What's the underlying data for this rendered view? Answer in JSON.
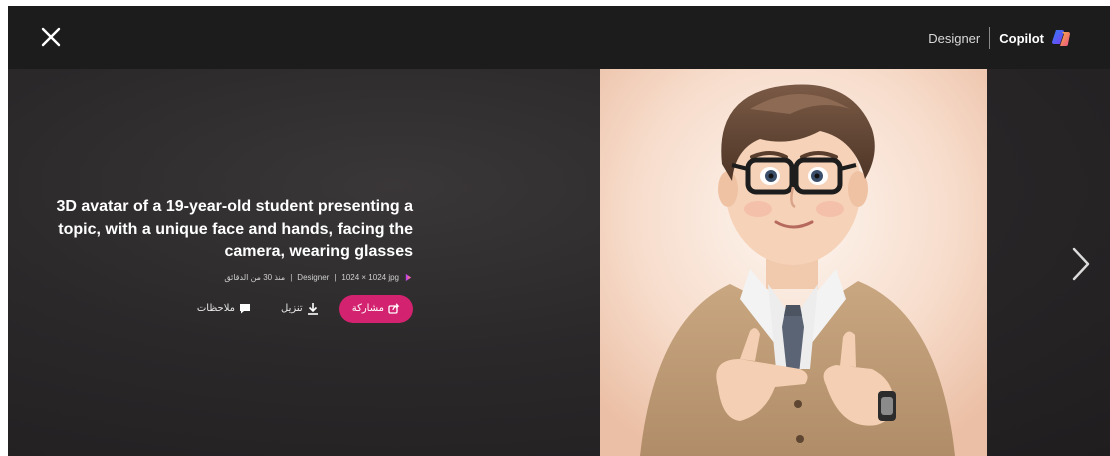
{
  "topbar": {
    "close_icon": "close-icon",
    "brand_designer": "Designer",
    "brand_copilot": "Copilot",
    "copilot_logo": "copilot-logo-icon"
  },
  "image_info": {
    "title_lines": [
      "3D avatar of a 19-year-old student presenting a",
      "topic, with a unique face and hands, facing the",
      "camera, wearing glasses"
    ],
    "meta": {
      "format": "1024 × 1024 jpg",
      "separator": "|",
      "app": "Designer",
      "time": "منذ 30 من الدقائق"
    }
  },
  "actions": {
    "share_label": "مشاركة",
    "download_label": "تنزيل",
    "feedback_label": "ملاحظات"
  },
  "navigation": {
    "next_icon": "chevron-right-icon"
  },
  "colors": {
    "share_button": "#d3226f",
    "topbar": "#1c1c1c",
    "background": "#2a2829"
  }
}
